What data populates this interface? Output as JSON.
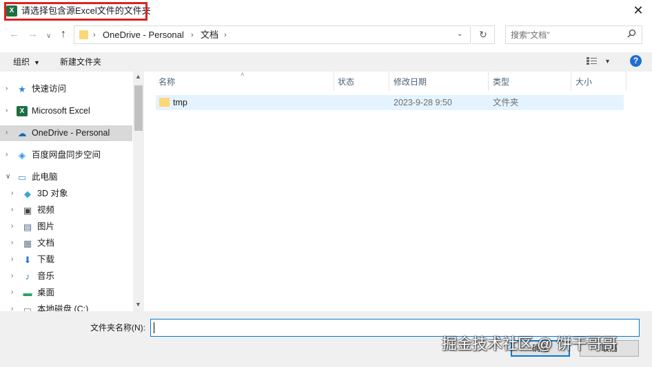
{
  "window": {
    "title": "请选择包含源Excel文件的文件夹",
    "app_icon_letter": "X",
    "close_glyph": "✕"
  },
  "navigation": {
    "back_glyph": "←",
    "forward_glyph": "→",
    "recent_glyph": "∨",
    "up_glyph": "↑",
    "address_segments": [
      "OneDrive - Personal",
      "文档"
    ],
    "separator": "›",
    "dropdown_glyph": "⌄",
    "refresh_glyph": "↻",
    "search_placeholder": "搜索\"文档\"",
    "search_icon": "search-icon"
  },
  "toolbar": {
    "organize_label": "组织",
    "new_folder_label": "新建文件夹",
    "view_icon": "view-list-icon",
    "help_label": "?"
  },
  "sidebar": {
    "items": [
      {
        "label": "快速访问",
        "icon": "star-icon",
        "glyph": "★",
        "color": "#2b88d8",
        "level": 0,
        "selected": false
      },
      {
        "label": "Microsoft Excel",
        "icon": "excel-icon",
        "glyph": "X",
        "color": "#1d6f42",
        "level": 0,
        "selected": false
      },
      {
        "label": "OneDrive - Personal",
        "icon": "cloud-icon",
        "glyph": "☁",
        "color": "#0f6cbd",
        "level": 0,
        "selected": true
      },
      {
        "label": "百度网盘同步空间",
        "icon": "baidu-sync-icon",
        "glyph": "◈",
        "color": "#2196f3",
        "level": 0,
        "selected": false
      },
      {
        "label": "此电脑",
        "icon": "computer-icon",
        "glyph": "▭",
        "color": "#3a8fd8",
        "level": 0,
        "selected": false,
        "expanded": true
      },
      {
        "label": "3D 对象",
        "icon": "3d-objects-icon",
        "glyph": "◆",
        "color": "#36a6d8",
        "level": 1,
        "selected": false
      },
      {
        "label": "视频",
        "icon": "video-icon",
        "glyph": "▣",
        "color": "#444444",
        "level": 1,
        "selected": false
      },
      {
        "label": "图片",
        "icon": "pictures-icon",
        "glyph": "▤",
        "color": "#556b8a",
        "level": 1,
        "selected": false
      },
      {
        "label": "文档",
        "icon": "documents-icon",
        "glyph": "▦",
        "color": "#6b7a8c",
        "level": 1,
        "selected": false
      },
      {
        "label": "下载",
        "icon": "download-icon",
        "glyph": "⬇",
        "color": "#2b7bd8",
        "level": 1,
        "selected": false
      },
      {
        "label": "音乐",
        "icon": "music-icon",
        "glyph": "♪",
        "color": "#1d7fd8",
        "level": 1,
        "selected": false
      },
      {
        "label": "桌面",
        "icon": "desktop-icon",
        "glyph": "▬",
        "color": "#2f9e6a",
        "level": 1,
        "selected": false
      },
      {
        "label": "本地磁盘 (C:)",
        "icon": "drive-icon",
        "glyph": "▭",
        "color": "#6b7a8c",
        "level": 1,
        "selected": false
      }
    ]
  },
  "file_list": {
    "columns": [
      "名称",
      "状态",
      "修改日期",
      "类型",
      "大小"
    ],
    "rows": [
      {
        "name": "tmp",
        "status": "",
        "modified": "2023-9-28 9:50",
        "type": "文件夹",
        "size": ""
      }
    ]
  },
  "footer": {
    "filename_label": "文件夹名称(N):",
    "filename_value": "",
    "ok_label": "确定",
    "cancel_label": "取消"
  },
  "watermark": "掘金技术社区 @ 饼干哥哥",
  "colors": {
    "highlight_box": "#e0201c",
    "selected_row": "#e5f3ff",
    "sidebar_selected": "#d9d9d9",
    "accent": "#0078d7",
    "folder": "#fcd776"
  }
}
